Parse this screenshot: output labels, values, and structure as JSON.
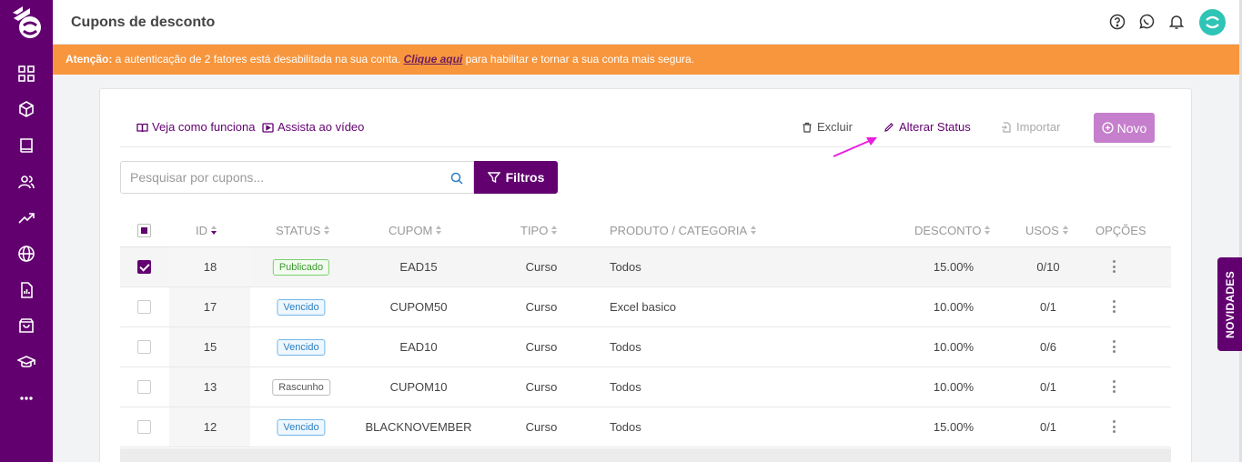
{
  "header": {
    "title": "Cupons de desconto"
  },
  "alert": {
    "prefix": "Atenção:",
    "text_before": " a autenticação de 2 fatores está desabilitada na sua conta. ",
    "link": "Clique aqui",
    "text_after": " para habilitar e tornar a sua conta mais segura."
  },
  "toolbar": {
    "how_it_works": "Veja como funciona",
    "watch_video": "Assista ao vídeo",
    "delete": "Excluir",
    "change_status": "Alterar Status",
    "import": "Importar",
    "new": "Novo"
  },
  "search": {
    "placeholder": "Pesquisar por cupons...",
    "filter_label": "Filtros"
  },
  "table": {
    "columns": [
      "ID",
      "STATUS",
      "CUPOM",
      "TIPO",
      "PRODUTO / CATEGORIA",
      "DESCONTO",
      "USOS",
      "OPÇÕES"
    ],
    "rows": [
      {
        "id": "18",
        "status": "Publicado",
        "coupon": "EAD15",
        "type": "Curso",
        "product": "Todos",
        "discount": "15.00%",
        "uses": "0/10"
      },
      {
        "id": "17",
        "status": "Vencido",
        "coupon": "CUPOM50",
        "type": "Curso",
        "product": "Excel basico",
        "discount": "10.00%",
        "uses": "0/1"
      },
      {
        "id": "15",
        "status": "Vencido",
        "coupon": "EAD10",
        "type": "Curso",
        "product": "Todos",
        "discount": "10.00%",
        "uses": "0/6"
      },
      {
        "id": "13",
        "status": "Rascunho",
        "coupon": "CUPOM10",
        "type": "Curso",
        "product": "Todos",
        "discount": "10.00%",
        "uses": "0/1"
      },
      {
        "id": "12",
        "status": "Vencido",
        "coupon": "BLACKNOVEMBER",
        "type": "Curso",
        "product": "Todos",
        "discount": "15.00%",
        "uses": "0/1"
      }
    ]
  },
  "side_tab": {
    "label": "NOVIDADES"
  },
  "colors": {
    "brand": "#620070",
    "alert": "#f7963d",
    "new_button": "#c57fcc",
    "annotation_arrow": "#e81ee0"
  }
}
